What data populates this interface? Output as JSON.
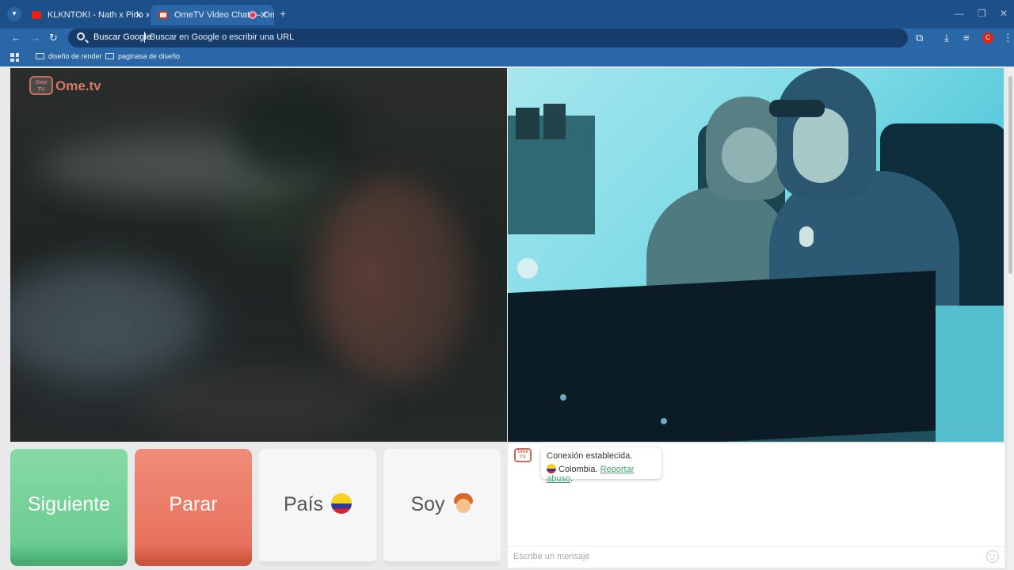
{
  "browser": {
    "tabs": [
      {
        "title": "KLKNTOKI - Nath x Pirlo x Che..."
      },
      {
        "title": "OmeTV Video Chat — Ome..."
      }
    ],
    "new_tab_symbol": "+",
    "close_symbol": "✕",
    "omnibox": {
      "engine_label": "Buscar Google",
      "placeholder": "Buscar en Google o escribir una URL"
    },
    "profile_initial": "C",
    "bookmarks": [
      {
        "label": "diseño de render"
      },
      {
        "label": "paginasa de diseño"
      }
    ]
  },
  "page": {
    "logo": {
      "badge": "Ome TV",
      "text": "Ome.tv"
    },
    "buttons": {
      "next": "Siguiente",
      "stop": "Parar",
      "country": "País",
      "gender": "Soy"
    },
    "chat": {
      "badge": "Ome TV",
      "status": "Conexión establecida.",
      "country": "Colombia.",
      "report": "Reportar abuso",
      "report_suffix": ".",
      "input_placeholder": "Escribe un mensaje"
    }
  },
  "colors": {
    "chrome_dark": "#1d4f89",
    "chrome_light": "#2b66a6",
    "next": "#6ccc90",
    "stop": "#e8735f",
    "link": "#45a36c"
  }
}
